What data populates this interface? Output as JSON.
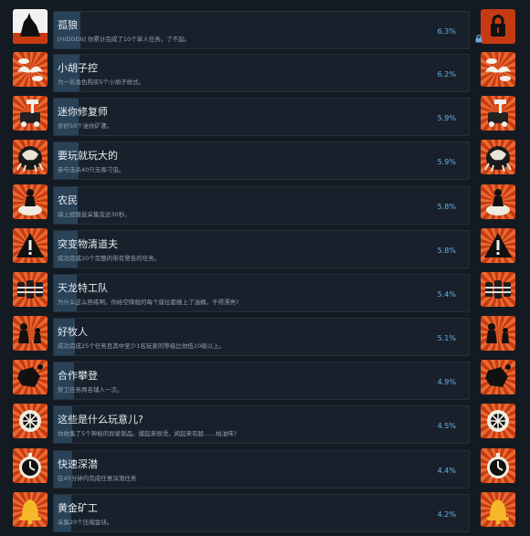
{
  "achievements": [
    {
      "title": "孤狼",
      "desc": "[HIDDEN] 你累计完成了10个单人任务。了不起。",
      "percent": "6.3%",
      "value": 6.3,
      "icon": "wolf-howl-icon",
      "locked": true
    },
    {
      "title": "小胡子控",
      "desc": "为一名角色购买5个小胡子样式。",
      "percent": "6.2%",
      "value": 6.2,
      "icon": "mustache-icon",
      "locked": false
    },
    {
      "title": "迷你修复师",
      "desc": "修好50个迷你矿骡。",
      "percent": "5.9%",
      "value": 5.9,
      "icon": "repair-hammer-icon",
      "locked": false
    },
    {
      "title": "要玩就玩大的",
      "desc": "参与击杀40只无畏刁虫。",
      "percent": "5.9%",
      "value": 5.9,
      "icon": "dreadnought-bug-icon",
      "locked": false
    },
    {
      "title": "农民",
      "desc": "骑上蛭酸盐采集虫达30秒。",
      "percent": "5.8%",
      "value": 5.8,
      "icon": "farmer-ride-icon",
      "locked": false
    },
    {
      "title": "突变物清道夫",
      "desc": "成功完成20个完整的带有警告的任务。",
      "percent": "5.8%",
      "value": 5.8,
      "icon": "warning-icon",
      "locked": false
    },
    {
      "title": "天龙特工队",
      "desc": "为什么这么熟练啊。你给空降舱的每个座位都缠上了油桶。干得漂亮?",
      "percent": "5.4%",
      "value": 5.4,
      "icon": "barrels-icon",
      "locked": false
    },
    {
      "title": "好牧人",
      "desc": "成功完成25个任务且其中至少1名玩家的等级比你低10级以上。",
      "percent": "5.1%",
      "value": 5.1,
      "icon": "shepherd-icon",
      "locked": false
    },
    {
      "title": "合作攀登",
      "desc": "警卫任务两名辅人一次。",
      "percent": "4.9%",
      "value": 4.9,
      "icon": "climb-boulder-icon",
      "locked": false
    },
    {
      "title": "这些是什么玩意儿?",
      "desc": "你收集了5个神秘的异星制品。摸起来很烫，闻起来有股……柏油味?",
      "percent": "4.5%",
      "value": 4.5,
      "icon": "artifact-cage-icon",
      "locked": false
    },
    {
      "title": "快速深潜",
      "desc": "在45分钟内完成任意深潜任务",
      "percent": "4.4%",
      "value": 4.4,
      "icon": "stopwatch-icon",
      "locked": false
    },
    {
      "title": "黄金矿工",
      "desc": "采集20个压缩金块。",
      "percent": "4.2%",
      "value": 4.2,
      "icon": "gold-bell-icon",
      "locked": false
    }
  ],
  "colors": {
    "progress": "#2a4257",
    "percent_text": "#67b3e5",
    "icon_bg": "#c63a12",
    "icon_ray": "#e86a32"
  }
}
